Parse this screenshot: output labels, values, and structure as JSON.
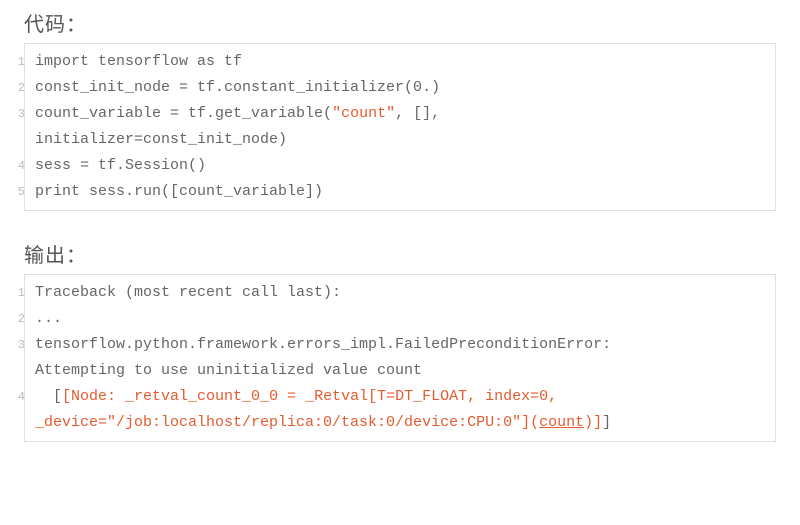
{
  "labels": {
    "code_heading": "代码：",
    "output_heading": "输出："
  },
  "code": {
    "line1": "import tensorflow as tf",
    "line2": "const_init_node = tf.constant_initializer(0.)",
    "line3_a": "count_variable = tf.get_variable(",
    "line3_str": "\"count\"",
    "line3_b": ", [], ",
    "line3_cont": "initializer=const_init_node)",
    "line4": "sess = tf.Session()",
    "line5": "print sess.run([count_variable])"
  },
  "code_lineno": {
    "l1": "1",
    "l2": "2",
    "l3": "3",
    "l4": "4",
    "l5": "5"
  },
  "output": {
    "line1": "Traceback (most recent call last):",
    "line2": "...",
    "line3": "tensorflow.python.framework.errors_impl.FailedPreconditionError: ",
    "line3_cont": "Attempting to use uninitialized value count",
    "line4_indent": "  [",
    "line4_a": "[Node: _retval_count_0_0 = _Retval[T=DT_FLOAT, index=0, ",
    "line4_b": "_device=\"/job:localhost/replica:0/task:0/device:CPU:0\"](",
    "line4_link": "count",
    "line4_c": ")]",
    "line4_end": "]"
  },
  "output_lineno": {
    "l1": "1",
    "l2": "2",
    "l3": "3",
    "l4": "4"
  }
}
